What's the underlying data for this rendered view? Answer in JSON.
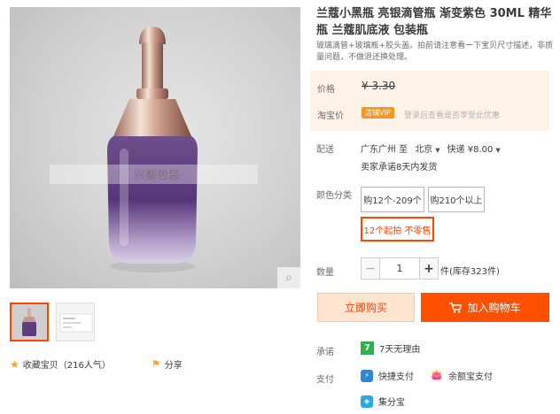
{
  "product": {
    "title": "兰蔻小黑瓶 亮银滴管瓶 渐变紫色 30ML 精华瓶 兰蔻肌底液 包装瓶",
    "subtitle": "玻璃滴管+玻璃瓶+胶头盖。拍前请注意看一下宝贝尺寸描述，非质量问题，不做退还换处理。",
    "image_watermark": "兴都包装",
    "zoom_icon": "magnifier-icon"
  },
  "price": {
    "label": "价格",
    "value": "¥ 3.30",
    "vip_label": "淘宝价",
    "vip_badge": "店铺VIP",
    "vip_text": "登录后查看是否享受此优惠",
    "accent": "#ff4400",
    "bg": "#fff2e8"
  },
  "shipping": {
    "label": "配送",
    "from": "广东广州 至",
    "to": "北京",
    "method": "快递 ¥8.00",
    "promise": "卖家承诺8天内发货"
  },
  "color": {
    "label": "颜色分类",
    "options": [
      "购12个-209个",
      "购210个以上",
      "12个起拍 不零售"
    ],
    "selected_index": 2
  },
  "quantity": {
    "label": "数量",
    "minus": "−",
    "value": "1",
    "plus": "+",
    "stock": "件(库存323件)"
  },
  "actions": {
    "buy": "立即购买",
    "cart": "加入购物车",
    "cart_icon": "shopping-cart-icon"
  },
  "guarantee": {
    "label": "承诺",
    "badge": "7",
    "text": "7天无理由"
  },
  "payment": {
    "label": "支付",
    "methods": [
      "快捷支付",
      "余额宝支付",
      "集分宝"
    ]
  },
  "social": {
    "favorite": "收藏宝贝（216人气）",
    "share": "分享"
  }
}
